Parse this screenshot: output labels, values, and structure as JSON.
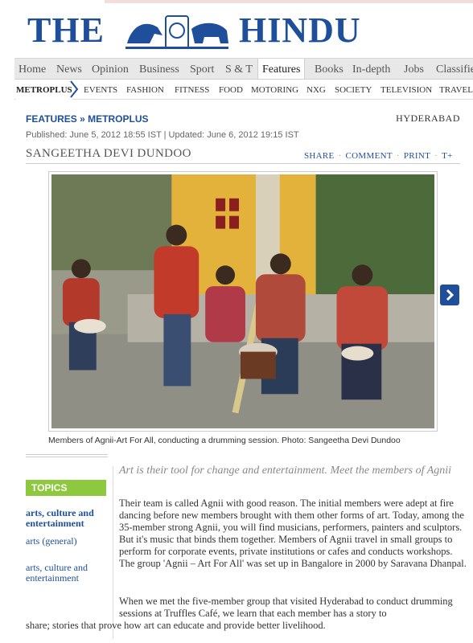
{
  "masthead": {
    "the": "THE",
    "hindu": "HINDU"
  },
  "main_nav": [
    "Home",
    "News",
    "Opinion",
    "Business",
    "Sport",
    "S & T",
    "Features",
    "Books",
    "In-depth",
    "Jobs",
    "Classifie"
  ],
  "main_nav_active": "Features",
  "sub_nav": [
    "METROPLUS",
    "EVENTS",
    "FASHION",
    "FITNESS",
    "FOOD",
    "MOTORING",
    "NXG",
    "SOCIETY",
    "TELEVISION",
    "TRAVEL"
  ],
  "crumb": {
    "section": "FEATURES",
    "sep": "»",
    "sub": "METROPLUS"
  },
  "location": "HYDERABAD",
  "dates": "Published: June 5, 2012 18:55 IST | Updated: June 6, 2012 19:15 IST",
  "byline": "SANGEETHA DEVI DUNDOO",
  "tools": {
    "share": "SHARE",
    "comment": "COMMENT",
    "print": "PRINT",
    "text": "T+"
  },
  "caption": "Members of Agnii-Art For All, conducting a drumming session. Photo: Sangeetha Devi Dundoo",
  "topics": {
    "heading": "TOPICS",
    "main": "arts, culture and entertainment",
    "items": [
      "arts (general)",
      "arts, culture and entertainment"
    ]
  },
  "article": {
    "standfirst": "Art is their tool for change and entertainment. Meet the members of Agnii",
    "para1": "Their team is called Agnii with good reason. The initial members were adept at fire dancing before new members brought with them other forms of art. Today, among the 35-member strong Agnii, you will find musicians, performers, painters and sculptors. But it's music that binds them together. Members of Agnii travel in small groups to perform for corporate events, private institutions or cafes and conducts workshops. The group 'Agnii – Art For All' was set up in Bangalore in 2000 by Saravana Dhanpal.",
    "para2_a": "When we met the five-member group that visited Hyderabad to conduct drumming sessions at Truffles Café, we learn that each member has a story to",
    "para2_b": "share; stories that prove how art can educate and provide better livelihood."
  },
  "colors": {
    "brand_blue": "#1f4f9a",
    "topics_green": "#8dc83e"
  }
}
